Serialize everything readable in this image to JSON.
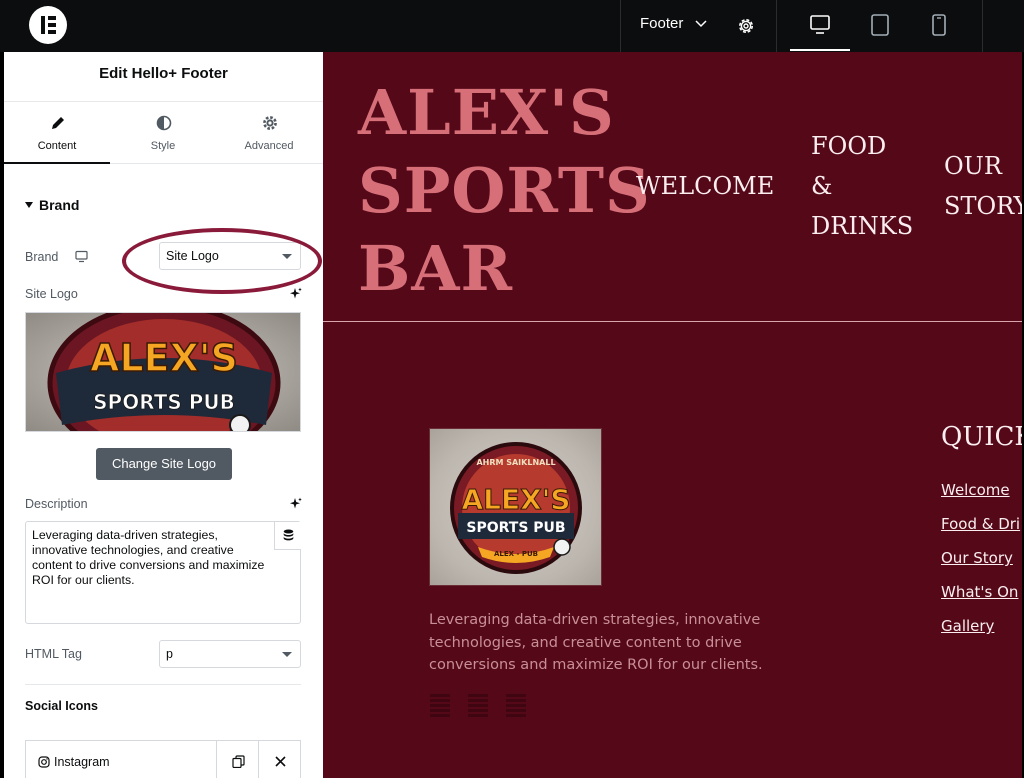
{
  "topbar": {
    "document_name": "Footer",
    "devices": [
      "desktop-icon",
      "tablet-icon",
      "mobile-icon"
    ]
  },
  "panel": {
    "title": "Edit Hello+ Footer",
    "tabs": [
      {
        "label": "Content",
        "icon": "pencil-icon"
      },
      {
        "label": "Style",
        "icon": "half-circle-icon"
      },
      {
        "label": "Advanced",
        "icon": "gear-icon"
      }
    ],
    "section": "Brand",
    "brand": {
      "label": "Brand",
      "value": "Site Logo"
    },
    "site_logo_label": "Site Logo",
    "logo_text_1": "ALEX'S",
    "logo_text_2": "SPORTS PUB",
    "change_logo_button": "Change Site Logo",
    "description": {
      "label": "Description",
      "value": "Leveraging data-driven strategies, innovative technologies, and creative content to drive conversions and maximize ROI for our clients."
    },
    "html_tag": {
      "label": "HTML Tag",
      "value": "p"
    },
    "social_icons_label": "Social Icons",
    "social_items": [
      "Instagram"
    ]
  },
  "canvas": {
    "brand_title": [
      "ALEX'S",
      "SPORTS",
      "BAR"
    ],
    "nav": [
      {
        "lines": [
          "WELCOME"
        ]
      },
      {
        "lines": [
          "FOOD",
          "&",
          "DRINKS"
        ]
      },
      {
        "lines": [
          "OUR",
          "STORY"
        ]
      }
    ],
    "logo_top_text": "AHRM SAIKLNALL",
    "logo_text_1": "ALEX'S",
    "logo_text_2": "SPORTS PUB",
    "logo_bottom_text": "ALEX - PUB",
    "description_lines": [
      "Leveraging data-driven strategies, innovative",
      "technologies, and creative content to drive",
      "conversions and maximize ROI for our clients."
    ],
    "quick_links_heading": "QUICK",
    "quick_links": [
      "Welcome",
      "Food & Dri",
      "Our Story",
      "What's On",
      "Gallery"
    ]
  },
  "colors": {
    "canvas_bg": "#540818",
    "brand_pink": "#d66f78",
    "annotation_ring": "#8a1a3a"
  }
}
